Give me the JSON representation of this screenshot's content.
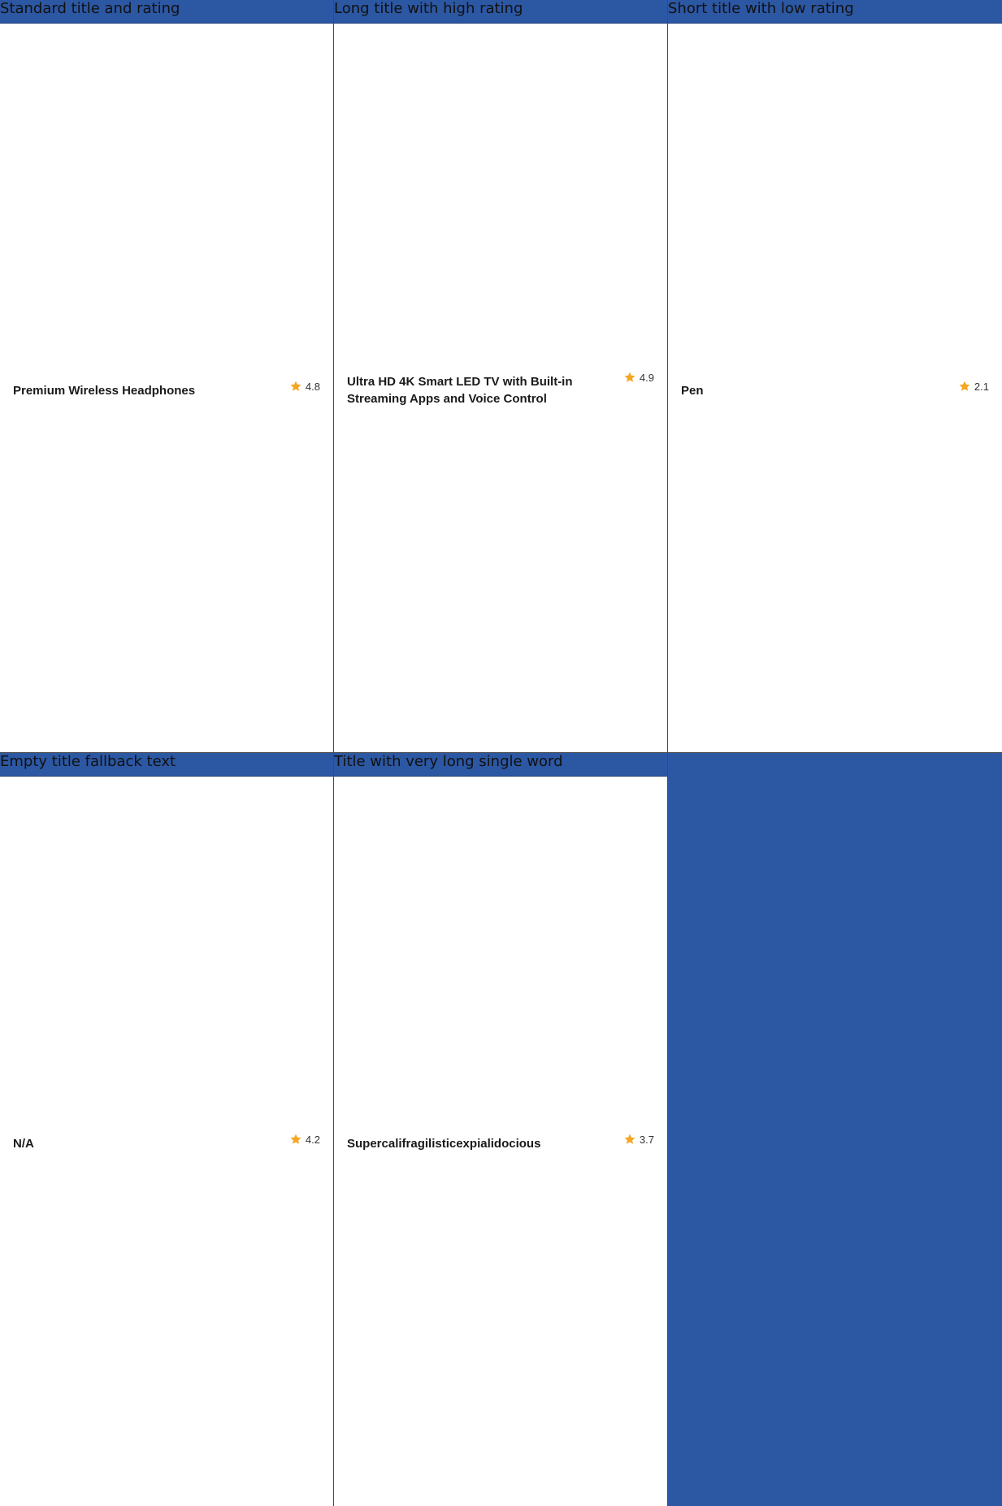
{
  "colors": {
    "header_bg": "#2c57a3",
    "card_bg": "#ffffff",
    "star": "#f5a623"
  },
  "cells": [
    {
      "header": "Standard title and rating",
      "title": "Premium Wireless Headphones",
      "rating": "4.8",
      "icon": "star-icon"
    },
    {
      "header": "Long title with high rating",
      "title": "Ultra HD 4K Smart LED TV with Built-in Streaming Apps and Voice Control",
      "rating": "4.9",
      "icon": "star-icon"
    },
    {
      "header": "Short title with low rating",
      "title": "Pen",
      "rating": "2.1",
      "icon": "star-icon"
    },
    {
      "header": "Empty title fallback text",
      "title": "N/A",
      "rating": "4.2",
      "icon": "star-icon"
    },
    {
      "header": "Title with very long single word",
      "title": "Supercalifragilisticexpialidocious",
      "rating": "3.7",
      "icon": "star-icon"
    }
  ]
}
